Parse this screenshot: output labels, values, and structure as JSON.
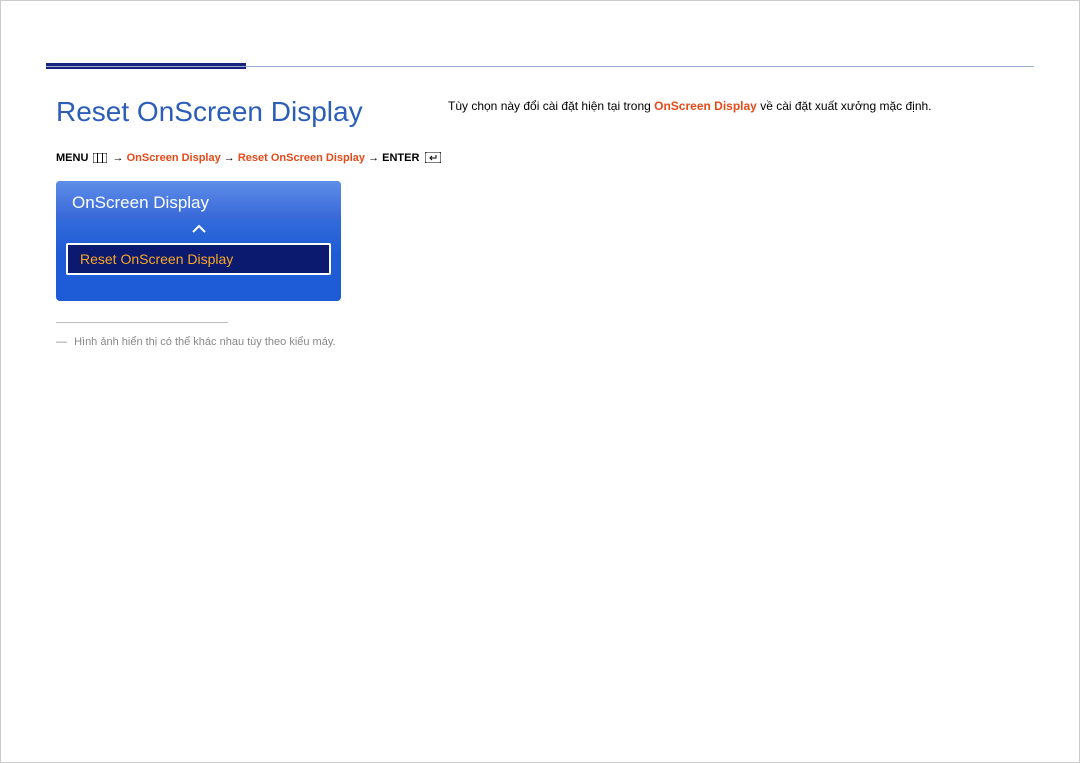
{
  "page": {
    "title": "Reset OnScreen Display"
  },
  "breadcrumb": {
    "menu_label": "MENU",
    "arrow": "→",
    "item1": "OnScreen Display",
    "item2": "Reset OnScreen Display",
    "enter_label": "ENTER"
  },
  "osd_panel": {
    "header": "OnScreen Display",
    "selected_item": "Reset OnScreen Display"
  },
  "footnote": {
    "text": "Hình ảnh hiển thị có thể khác nhau tùy theo kiểu máy."
  },
  "description": {
    "pre": "Tùy chọn này đổi cài đặt hiện tại trong ",
    "highlight": "OnScreen Display",
    "post": " về cài đặt xuất xưởng mặc định."
  }
}
